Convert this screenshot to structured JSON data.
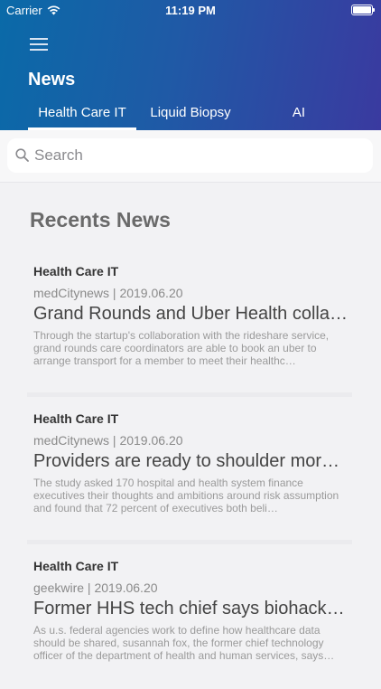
{
  "status": {
    "carrier": "Carrier",
    "time": "11:19 PM"
  },
  "header": {
    "title": "News"
  },
  "tabs": [
    {
      "label": "Health Care IT",
      "active": true
    },
    {
      "label": "Liquid Biopsy",
      "active": false
    },
    {
      "label": "AI",
      "active": false
    }
  ],
  "search": {
    "placeholder": "Search"
  },
  "section": {
    "title": "Recents News"
  },
  "articles": [
    {
      "category": "Health Care IT",
      "meta": "medCitynews | 2019.06.20",
      "title": "Grand Rounds and Uber Health collab…",
      "body": "Through the startup's collaboration with the rideshare service, grand rounds care coordinators are able to book an uber to arrange transport for a member to meet their healthc…"
    },
    {
      "category": "Health Care IT",
      "meta": "medCitynews | 2019.06.20",
      "title": "Providers are ready to shoulder more…",
      "body": "The study asked 170 hospital and health system finance executives their thoughts and ambitions around risk assumption and found that 72 percent of executives both beli…"
    },
    {
      "category": "Health Care IT",
      "meta": "geekwire | 2019.06.20",
      "title": "Former HHS tech chief says biohacke…",
      "body": "As u.s. federal agencies work to define how healthcare data should be shared, susannah fox, the former chief technology officer of the department of health and human services, says…"
    }
  ]
}
